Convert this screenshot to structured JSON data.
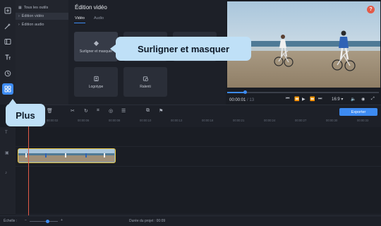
{
  "sidebar": {
    "icons": [
      "import-icon",
      "magic-icon",
      "film-icon",
      "text-icon",
      "clock-icon",
      "grid-icon"
    ],
    "active": "grid-icon"
  },
  "tools": {
    "items": [
      {
        "label": "Tous les outils"
      },
      {
        "label": "Édition vidéo"
      },
      {
        "label": "Édition audio"
      }
    ]
  },
  "panel": {
    "title": "Édition vidéo",
    "tabs": [
      "Vidéo",
      "Audio"
    ],
    "effects": [
      {
        "label": "Surligner et masquer"
      },
      {
        "label": "Logotype"
      },
      {
        "label": "Ralenti"
      }
    ]
  },
  "preview": {
    "help_label": "?",
    "timecode": "00:00:01",
    "duration_hint": "/ 13",
    "aspect": "16:9",
    "scrub_progress": 0.12
  },
  "toolbar": {
    "export_label": "Exporter"
  },
  "timeline": {
    "ticks": [
      "00:00:02",
      "00:00:06",
      "00:00:08",
      "00:00:10",
      "00:00:13",
      "00:00:18",
      "00:00:21",
      "00:00:24",
      "00:00:27",
      "00:00:30",
      "00:00:33"
    ]
  },
  "status": {
    "scale_label": "Échelle :",
    "project_duration": "Durée du projet : 00:09"
  },
  "callouts": {
    "effect": "Surligner et masquer",
    "more": "Plus"
  },
  "colors": {
    "accent": "#3d8bf2",
    "callout": "#bfe0f7",
    "playhead": "#e35a48",
    "clip_border": "#e6c23a"
  }
}
